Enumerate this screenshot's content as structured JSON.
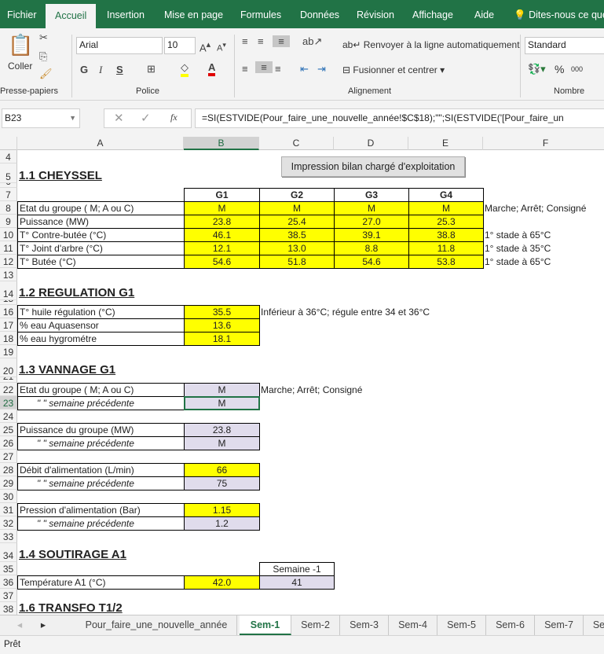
{
  "menu": {
    "tabs": [
      "Fichier",
      "Accueil",
      "Insertion",
      "Mise en page",
      "Formules",
      "Données",
      "Révision",
      "Affichage",
      "Aide"
    ],
    "active": "Accueil",
    "tell_me": "Dites-nous ce que"
  },
  "ribbon": {
    "paste_label": "Coller",
    "font_name": "Arial",
    "font_size": "10",
    "bold": "G",
    "italic": "I",
    "underline": "S",
    "wrap_text": "Renvoyer à la ligne automatiquement",
    "merge_center": "Fusionner et centrer",
    "number_format": "Standard",
    "percent": "%",
    "thousands": "000",
    "groups": [
      "Presse-papiers",
      "Police",
      "Alignement",
      "Nombre"
    ],
    "fill_color": "#ffff00",
    "font_color": "#e00000"
  },
  "formula_bar": {
    "name_box": "B23",
    "formula": "=SI(ESTVIDE(Pour_faire_une_nouvelle_année!$C$18);\"\";SI(ESTVIDE('[Pour_faire_un"
  },
  "columns": [
    "A",
    "B",
    "C",
    "D",
    "E",
    "F"
  ],
  "selected_cell": "B23",
  "print_button": "Impression bilan chargé d'exploitation",
  "rows": [
    {
      "n": 4,
      "cells": []
    },
    {
      "n": 5,
      "cells": [
        {
          "col": "A",
          "text": "1.1  CHEYSSEL",
          "style": "title"
        }
      ]
    },
    {
      "n": 6,
      "cells": []
    },
    {
      "n": 7,
      "cells": [
        {
          "col": "B",
          "text": "G1",
          "style": "hdr"
        },
        {
          "col": "C",
          "text": "G2",
          "style": "hdr"
        },
        {
          "col": "D",
          "text": "G3",
          "style": "hdr"
        },
        {
          "col": "E",
          "text": "G4",
          "style": "hdr"
        }
      ]
    },
    {
      "n": 8,
      "cells": [
        {
          "col": "A",
          "text": "Etat du groupe ( M; A ou C)",
          "style": "label"
        },
        {
          "col": "B",
          "text": "M",
          "style": "yellow"
        },
        {
          "col": "C",
          "text": "M",
          "style": "yellow"
        },
        {
          "col": "D",
          "text": "M",
          "style": "yellow"
        },
        {
          "col": "E",
          "text": "M",
          "style": "yellow"
        },
        {
          "col": "F",
          "text": "Marche; Arrêt; Consigné",
          "style": "note"
        }
      ]
    },
    {
      "n": 9,
      "cells": [
        {
          "col": "A",
          "text": "Puissance (MW)",
          "style": "label"
        },
        {
          "col": "B",
          "text": "23.8",
          "style": "yellow"
        },
        {
          "col": "C",
          "text": "25.4",
          "style": "yellow"
        },
        {
          "col": "D",
          "text": "27.0",
          "style": "yellow"
        },
        {
          "col": "E",
          "text": "25.3",
          "style": "yellow"
        }
      ]
    },
    {
      "n": 10,
      "cells": [
        {
          "col": "A",
          "text": "T° Contre-butée (°C)",
          "style": "label"
        },
        {
          "col": "B",
          "text": "46.1",
          "style": "yellow"
        },
        {
          "col": "C",
          "text": "38.5",
          "style": "yellow"
        },
        {
          "col": "D",
          "text": "39.1",
          "style": "yellow"
        },
        {
          "col": "E",
          "text": "38.8",
          "style": "yellow"
        },
        {
          "col": "F",
          "text": "1° stade à 65°C",
          "style": "note"
        }
      ]
    },
    {
      "n": 11,
      "cells": [
        {
          "col": "A",
          "text": "T° Joint d'arbre (°C)",
          "style": "label"
        },
        {
          "col": "B",
          "text": "12.1",
          "style": "yellow"
        },
        {
          "col": "C",
          "text": "13.0",
          "style": "yellow"
        },
        {
          "col": "D",
          "text": "8.8",
          "style": "yellow"
        },
        {
          "col": "E",
          "text": "11.8",
          "style": "yellow"
        },
        {
          "col": "F",
          "text": "1° stade à 35°C",
          "style": "note"
        }
      ]
    },
    {
      "n": 12,
      "cells": [
        {
          "col": "A",
          "text": "T° Butée (°C)",
          "style": "label"
        },
        {
          "col": "B",
          "text": "54.6",
          "style": "yellow"
        },
        {
          "col": "C",
          "text": "51.8",
          "style": "yellow"
        },
        {
          "col": "D",
          "text": "54.6",
          "style": "yellow"
        },
        {
          "col": "E",
          "text": "53.8",
          "style": "yellow"
        },
        {
          "col": "F",
          "text": "1° stade à 65°C",
          "style": "note"
        }
      ]
    },
    {
      "n": 13,
      "cells": []
    },
    {
      "n": 14,
      "cells": [
        {
          "col": "A",
          "text": "1.2  REGULATION G1",
          "style": "title"
        }
      ]
    },
    {
      "n": 15,
      "cells": []
    },
    {
      "n": 16,
      "cells": [
        {
          "col": "A",
          "text": "T° huile régulation (°C)",
          "style": "label"
        },
        {
          "col": "B",
          "text": "35.5",
          "style": "yellow"
        },
        {
          "col": "C",
          "text": "Inférieur à 36°C; régule entre 34 et 36°C",
          "style": "note"
        }
      ]
    },
    {
      "n": 17,
      "cells": [
        {
          "col": "A",
          "text": "% eau Aquasensor",
          "style": "label"
        },
        {
          "col": "B",
          "text": "13.6",
          "style": "yellow"
        }
      ]
    },
    {
      "n": 18,
      "cells": [
        {
          "col": "A",
          "text": "% eau hygrométre",
          "style": "label"
        },
        {
          "col": "B",
          "text": "18.1",
          "style": "yellow"
        }
      ]
    },
    {
      "n": 19,
      "cells": []
    },
    {
      "n": 20,
      "cells": [
        {
          "col": "A",
          "text": "1.3  VANNAGE G1",
          "style": "title"
        }
      ]
    },
    {
      "n": 21,
      "cells": []
    },
    {
      "n": 22,
      "cells": [
        {
          "col": "A",
          "text": "Etat du groupe ( M; A ou C)",
          "style": "label"
        },
        {
          "col": "B",
          "text": "M",
          "style": "lav"
        },
        {
          "col": "C",
          "text": "Marche; Arrêt; Consigné",
          "style": "note"
        }
      ]
    },
    {
      "n": 23,
      "cells": [
        {
          "col": "A",
          "text": "\"        \"      semaine précédente",
          "style": "ditto"
        },
        {
          "col": "B",
          "text": "M",
          "style": "lav"
        }
      ]
    },
    {
      "n": 24,
      "cells": []
    },
    {
      "n": 25,
      "cells": [
        {
          "col": "A",
          "text": "Puissance du groupe (MW)",
          "style": "label"
        },
        {
          "col": "B",
          "text": "23.8",
          "style": "lav"
        }
      ]
    },
    {
      "n": 26,
      "cells": [
        {
          "col": "A",
          "text": "\"        \"      semaine précédente",
          "style": "ditto"
        },
        {
          "col": "B",
          "text": "M",
          "style": "lav"
        }
      ]
    },
    {
      "n": 27,
      "cells": []
    },
    {
      "n": 28,
      "cells": [
        {
          "col": "A",
          "text": "Débit d'alimentation (L/min)",
          "style": "label"
        },
        {
          "col": "B",
          "text": "66",
          "style": "yellow"
        }
      ]
    },
    {
      "n": 29,
      "cells": [
        {
          "col": "A",
          "text": "\"        \"      semaine précédente",
          "style": "ditto"
        },
        {
          "col": "B",
          "text": "75",
          "style": "lav"
        }
      ]
    },
    {
      "n": 30,
      "cells": []
    },
    {
      "n": 31,
      "cells": [
        {
          "col": "A",
          "text": "Pression d'alimentation (Bar)",
          "style": "label"
        },
        {
          "col": "B",
          "text": "1.15",
          "style": "yellow"
        }
      ]
    },
    {
      "n": 32,
      "cells": [
        {
          "col": "A",
          "text": "\"        \"      semaine précédente",
          "style": "ditto"
        },
        {
          "col": "B",
          "text": "1.2",
          "style": "lav"
        }
      ]
    },
    {
      "n": 33,
      "cells": []
    },
    {
      "n": 34,
      "cells": [
        {
          "col": "A",
          "text": "1.4  SOUTIRAGE A1",
          "style": "title"
        }
      ]
    },
    {
      "n": 35,
      "cells": [
        {
          "col": "C",
          "text": "Semaine -1",
          "style": "hdrn"
        }
      ]
    },
    {
      "n": 36,
      "cells": [
        {
          "col": "A",
          "text": "Température A1 (°C)",
          "style": "label"
        },
        {
          "col": "B",
          "text": "42.0",
          "style": "yellow"
        },
        {
          "col": "C",
          "text": "41",
          "style": "lav"
        }
      ]
    },
    {
      "n": 37,
      "cells": []
    },
    {
      "n": 38,
      "cells": [
        {
          "col": "A",
          "text": "1.6  TRANSFO T1/2",
          "style": "title"
        }
      ]
    }
  ],
  "sheet_tabs": [
    "Pour_faire_une_nouvelle_année",
    "Sem-1",
    "Sem-2",
    "Sem-3",
    "Sem-4",
    "Sem-5",
    "Sem-6",
    "Sem-7",
    "Se"
  ],
  "active_sheet": "Sem-1",
  "status": "Prêt"
}
